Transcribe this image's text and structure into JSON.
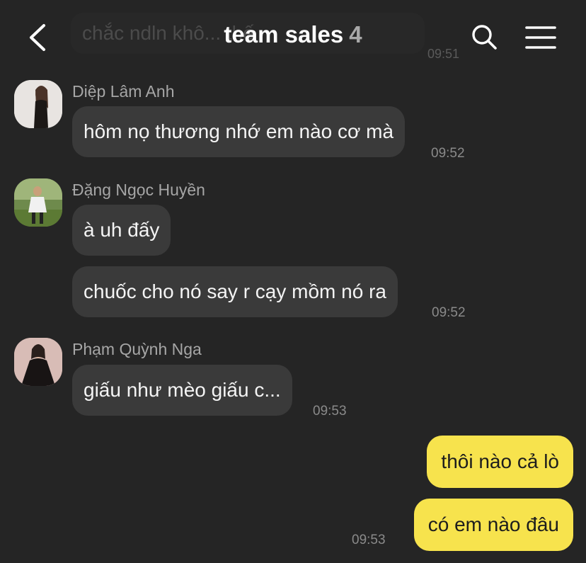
{
  "header": {
    "back_icon": "chevron-left-icon",
    "title": "team sales",
    "member_count": "4",
    "search_icon": "search-icon",
    "menu_icon": "menu-icon",
    "ghost_text": "chắc ndln khô... thế",
    "ghost_time": "09:51"
  },
  "messages": [
    {
      "sender": "Diệp Lâm Anh",
      "bubbles": [
        "hôm nọ thương nhớ em nào cơ mà"
      ],
      "time": "09:52"
    },
    {
      "sender": "Đặng Ngọc Huyền",
      "bubbles": [
        "à uh đấy",
        "chuốc cho nó say r cạy mồm nó ra"
      ],
      "time": "09:52"
    },
    {
      "sender": "Phạm Quỳnh Nga",
      "bubbles": [
        "giấu như mèo giấu c..."
      ],
      "time": "09:53"
    }
  ],
  "my_messages": {
    "bubbles": [
      "thôi nào cả lò",
      "có em nào đâu"
    ],
    "time": "09:53"
  },
  "colors": {
    "background": "#252525",
    "incoming_bubble": "#3a3a3a",
    "outgoing_bubble": "#f7e34d",
    "count": "#a9a9a9"
  }
}
